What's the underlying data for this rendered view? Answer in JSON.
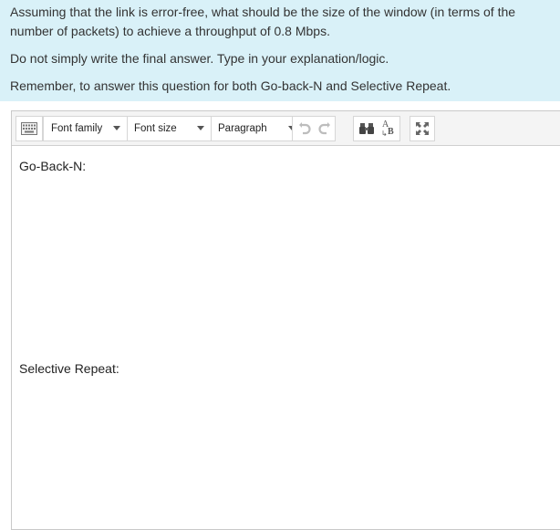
{
  "question": {
    "line1": "Assuming that the link is error-free, what should be the size of the window (in terms of the",
    "line2": "number of packets) to achieve a throughput of 0.8 Mbps.",
    "instruction": "Do not simply write the final answer. Type in your explanation/logic.",
    "reminder": "Remember, to answer this question for both Go-back-N and Selective Repeat."
  },
  "toolbar": {
    "keyboard_icon": "keyboard-icon",
    "font_family_label": "Font family",
    "font_size_label": "Font size",
    "paragraph_label": "Paragraph",
    "undo_icon": "undo-icon",
    "redo_icon": "redo-icon",
    "find_icon": "binoculars-icon",
    "replace_icon": "find-replace-icon",
    "replace_glyph_a": "A",
    "replace_glyph_b": "B",
    "fullscreen_icon": "fullscreen-icon"
  },
  "editor": {
    "line1": "Go-Back-N:",
    "line2": "Selective Repeat:"
  },
  "colors": {
    "question_bg": "#d9f1f8",
    "toolbar_bg": "#f4f4f4",
    "border": "#c9c9c9"
  }
}
